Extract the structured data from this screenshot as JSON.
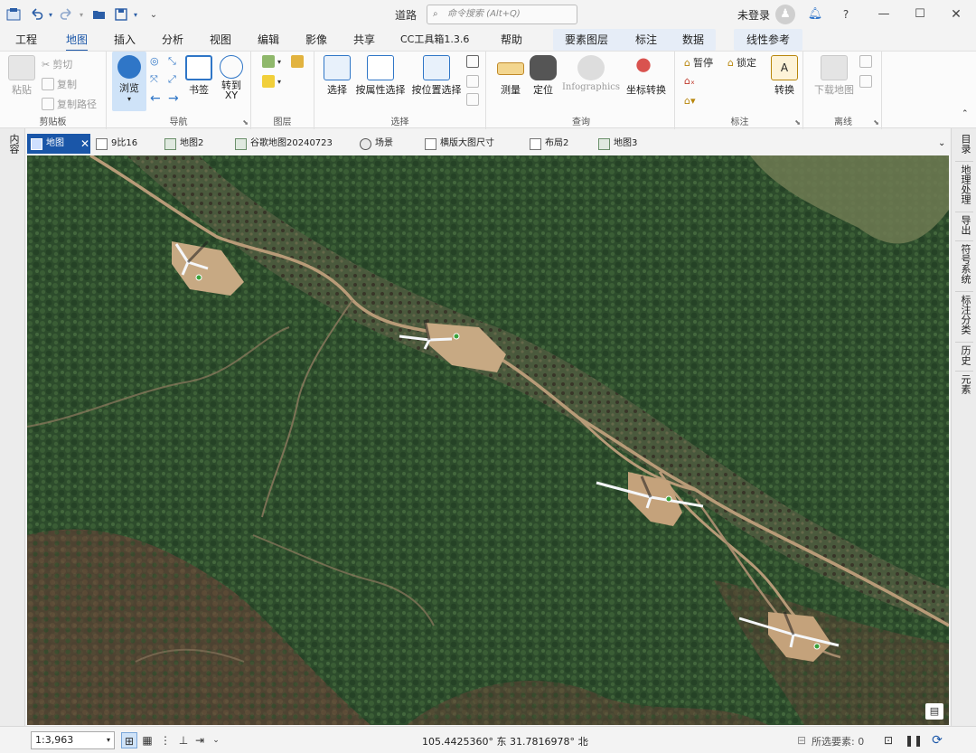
{
  "title_bar": {
    "title": "道路",
    "search_placeholder": "命令搜索 (Alt+Q)",
    "login_label": "未登录",
    "help_label": "?"
  },
  "ribbon_tabs": [
    "工程",
    "地图",
    "插入",
    "分析",
    "视图",
    "编辑",
    "影像",
    "共享",
    "CC工具箱1.3.6",
    "帮助",
    "要素图层",
    "标注",
    "数据",
    "线性参考"
  ],
  "active_ribbon_tab": "地图",
  "ribbon": {
    "clipboard": {
      "paste": "粘贴",
      "cut": "剪切",
      "copy": "复制",
      "copy_path": "复制路径",
      "label": "剪贴板"
    },
    "navigate": {
      "explore": "浏览",
      "bookmarks": "书签",
      "goto_xy": "转到\nXY",
      "label": "导航"
    },
    "layer": {
      "label": "图层"
    },
    "selection": {
      "select": "选择",
      "select_by_attr": "按属性选择",
      "select_by_loc": "按位置选择",
      "label": "选择"
    },
    "inquiry": {
      "measure": "测量",
      "locate": "定位",
      "infographics": "Infographics",
      "convert_coords": "坐标转换",
      "label": "查询"
    },
    "labeling": {
      "pause": "暂停",
      "lock": "锁定",
      "convert": "转换",
      "label": "标注"
    },
    "offline": {
      "download_map": "下载地图",
      "label": "离线"
    }
  },
  "doc_tabs": [
    {
      "label": "地图",
      "active": true,
      "icon": "map-icon"
    },
    {
      "label": "9比16",
      "active": false,
      "icon": "layout-icon"
    },
    {
      "label": "地图2",
      "active": false,
      "icon": "map-icon"
    },
    {
      "label": "谷歌地图20240723",
      "active": false,
      "icon": "map-icon"
    },
    {
      "label": "场景",
      "active": false,
      "icon": "scene-icon"
    },
    {
      "label": "横版大图尺寸",
      "active": false,
      "icon": "layout-icon"
    },
    {
      "label": "布局2",
      "active": false,
      "icon": "layout-icon"
    },
    {
      "label": "地图3",
      "active": false,
      "icon": "map-icon"
    }
  ],
  "left_pane": {
    "label": "内容"
  },
  "right_pane": [
    "目录",
    "地理处理",
    "导出",
    "符号系统",
    "标注分类",
    "历史",
    "元素"
  ],
  "status_bar": {
    "scale": "1:3,963",
    "coordinates": "105.4425360° 东  31.7816978° 北",
    "selected_features": "所选要素: 0"
  },
  "colors": {
    "accent": "#1a56a8",
    "forest": "#2c4a2a",
    "road": "#b89b78"
  }
}
